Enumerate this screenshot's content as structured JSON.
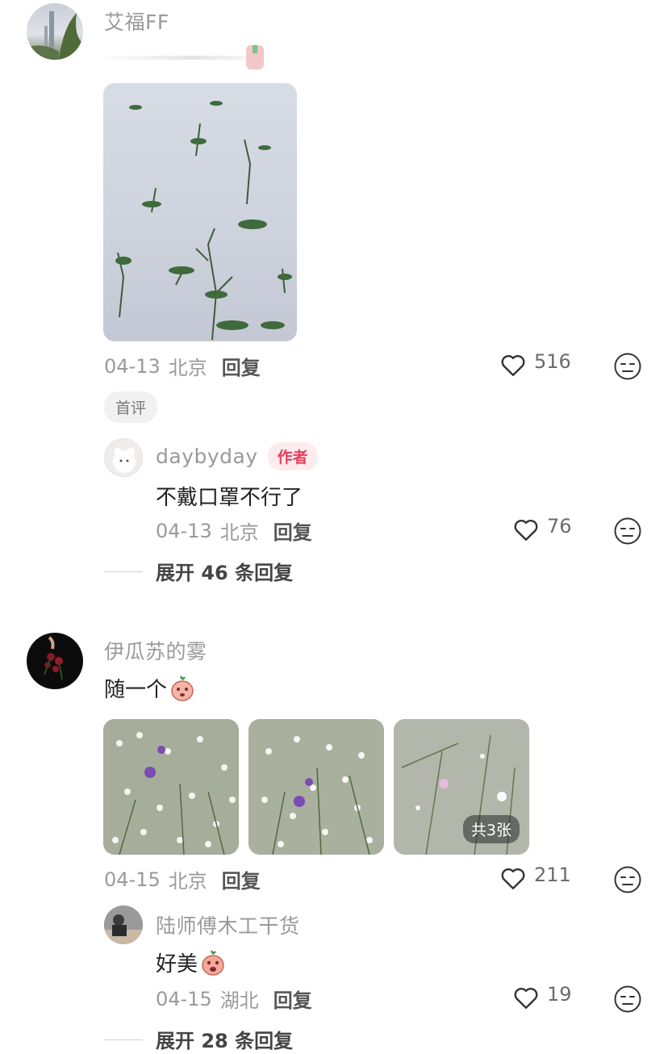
{
  "comments": [
    {
      "username": "艾福FF",
      "date": "04-13",
      "location": "北京",
      "reply_label": "回复",
      "likes": "516",
      "badge": "首评",
      "reply": {
        "username": "daybyday",
        "author_badge": "作者",
        "text": "不戴口罩不行了",
        "date": "04-13",
        "location": "北京",
        "reply_label": "回复",
        "likes": "76"
      },
      "expand_label": "展开 46 条回复"
    },
    {
      "username": "伊瓜苏的雾",
      "text": "随一个",
      "date": "04-15",
      "location": "北京",
      "reply_label": "回复",
      "likes": "211",
      "photo_count_label": "共3张",
      "reply": {
        "username": "陆师傅木工干货",
        "text": "好美",
        "date": "04-15",
        "location": "湖北",
        "reply_label": "回复",
        "likes": "19"
      },
      "expand_label": "展开 28 条回复"
    }
  ],
  "icons": {
    "like": "heart-outline-icon",
    "dislike": "unamused-face-icon"
  }
}
